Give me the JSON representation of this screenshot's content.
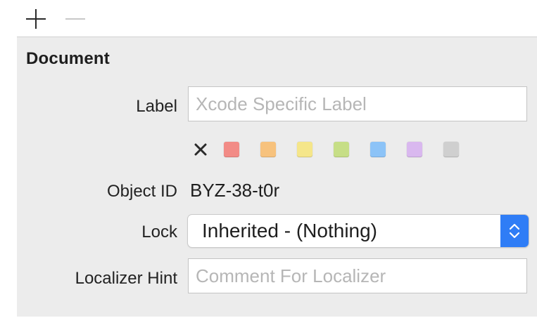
{
  "toolbar": {
    "add_icon": "plus-icon",
    "remove_icon": "minus-icon"
  },
  "document": {
    "section_title": "Document",
    "label": {
      "label": "Label",
      "value": "",
      "placeholder": "Xcode Specific Label"
    },
    "color_labels": {
      "clear_icon": "x-icon",
      "swatches": [
        {
          "name": "red",
          "color": "#f28b86"
        },
        {
          "name": "orange",
          "color": "#f7c27d"
        },
        {
          "name": "yellow",
          "color": "#f5e68a"
        },
        {
          "name": "green",
          "color": "#c6de86"
        },
        {
          "name": "blue",
          "color": "#8cc3f7"
        },
        {
          "name": "purple",
          "color": "#d9b8ef"
        },
        {
          "name": "gray",
          "color": "#cfcfcf"
        }
      ]
    },
    "object_id": {
      "label": "Object ID",
      "value": "BYZ-38-t0r"
    },
    "lock": {
      "label": "Lock",
      "selected": "Inherited - (Nothing)",
      "icon": "chevron-up-down-icon"
    },
    "localizer_hint": {
      "label": "Localizer Hint",
      "value": "",
      "placeholder": "Comment For Localizer"
    }
  },
  "colors": {
    "accent": "#2f7df6",
    "panel_background": "#ececec"
  }
}
